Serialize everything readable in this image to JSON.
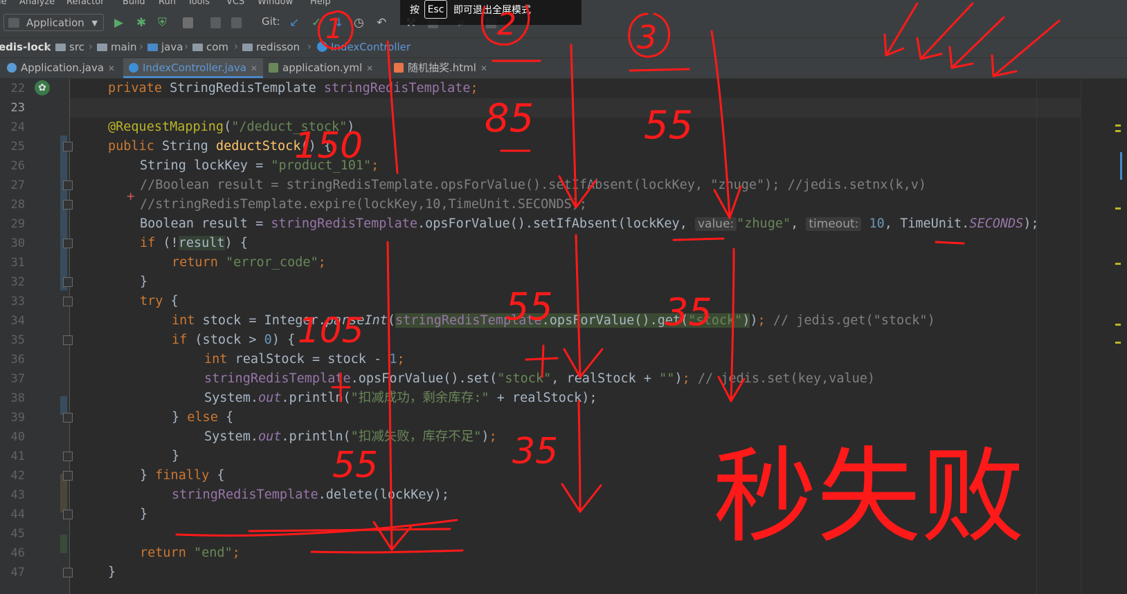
{
  "menu": [
    "le",
    "Analyze",
    "Refactor",
    "Build",
    "Run",
    "Tools",
    "VCS",
    "Window",
    "Help"
  ],
  "toolbar": {
    "run_config": "Application",
    "git_label": "Git:"
  },
  "fullscreen_hint": {
    "prefix": "按",
    "key": "Esc",
    "suffix": "即可退出全屏模式"
  },
  "breadcrumb": [
    "edis-lock",
    "src",
    "main",
    "java",
    "com",
    "redisson",
    "IndexController"
  ],
  "tabs": [
    {
      "label": "Application.java",
      "active": false
    },
    {
      "label": "IndexController.java",
      "active": true
    },
    {
      "label": "application.yml",
      "active": false
    },
    {
      "label": "随机抽奖.html",
      "active": false
    }
  ],
  "editor": {
    "line_numbers": [
      "22",
      "23",
      "24",
      "25",
      "26",
      "27",
      "28",
      "29",
      "30",
      "31",
      "32",
      "33",
      "34",
      "35",
      "36",
      "37",
      "38",
      "39",
      "40",
      "41",
      "42",
      "43",
      "44",
      "45",
      "46",
      "47"
    ],
    "code": {
      "l22_mod": "private",
      "l22_type": "StringRedisTemplate",
      "l22_field": "stringRedisTemplate",
      "l24_annotation": "@RequestMapping",
      "l24_path": "\"/deduct_stock\"",
      "l25_mods": "public",
      "l25_type": "String",
      "l25_name": "deductStock",
      "l26_decl": "String lockKey = ",
      "l26_value": "\"product_101\"",
      "l27_comment": "//Boolean result = stringRedisTemplate.opsForValue().setIfAbsent(lockKey, \"zhuge\"); //jedis.setnx(k,v)",
      "l28_comment": "//stringRedisTemplate.expire(lockKey,10,TimeUnit.SECONDS);",
      "l29_decl": "Boolean result = ",
      "l29_field": "stringRedisTemplate",
      "l29_call": ".opsForValue().setIfAbsent(",
      "l29_arg1": "lockKey",
      "l29_hint_value": "value:",
      "l29_arg2": "\"zhuge\"",
      "l29_hint_timeout": "timeout:",
      "l29_arg3": "10",
      "l29_unit": "TimeUnit.",
      "l29_unit_const": "SECONDS",
      "l29_end": ");",
      "l30_kw": "if",
      "l30_var": "result",
      "l31_kw": "return",
      "l31_value": "\"error_code\"",
      "l33_kw": "try",
      "l34_kw": "int",
      "l34_decl": " stock = Integer.",
      "l34_method": "parseInt",
      "l34_field": "stringRedisTemplate",
      "l34_call": ".opsForValue().get(",
      "l34_arg": "\"stock\"",
      "l34_comment": "// jedis.get(\"stock\")",
      "l35_kw": "if",
      "l35_cond": " (stock > ",
      "l35_num": "0",
      "l36_kw": "int",
      "l36_expr": " realStock = stock - ",
      "l36_num": "1",
      "l37_field": "stringRedisTemplate",
      "l37_call": ".opsForValue().set(",
      "l37_arg1": "\"stock\"",
      "l37_mid": ", realStock + ",
      "l37_arg2": "\"\"",
      "l37_comment": "// jedis.set(key,value)",
      "l38_prefix": "System.",
      "l38_out": "out",
      "l38_call": ".println(",
      "l38_str": "\"扣减成功，剩余库存:\"",
      "l38_tail": " + realStock);",
      "l39_kw": "else",
      "l40_prefix": "System.",
      "l40_out": "out",
      "l40_call": ".println(",
      "l40_str": "\"扣减失败，库存不足\"",
      "l42_kw": "finally",
      "l43_field": "stringRedisTemplate",
      "l43_call": ".delete(lockKey);",
      "l46_kw": "return",
      "l46_value": "\"end\""
    }
  },
  "annotations": {
    "circle_1": "1",
    "circle_2": "2",
    "circle_3": "3",
    "n_150": "150",
    "n_85": "85",
    "n_55_top": "55",
    "n_105": "105",
    "n_55_mid": "55",
    "n_35_mid": "35",
    "n_55_bottom": "55",
    "n_35_bottom": "35",
    "chinese_note": "秒失败"
  },
  "colors": {
    "editor_bg": "#2b2b2b",
    "keyword": "#cc7832",
    "string": "#6a8759",
    "field": "#9876aa",
    "annotation": "#bbb529",
    "ink": "#ff1a1a"
  }
}
